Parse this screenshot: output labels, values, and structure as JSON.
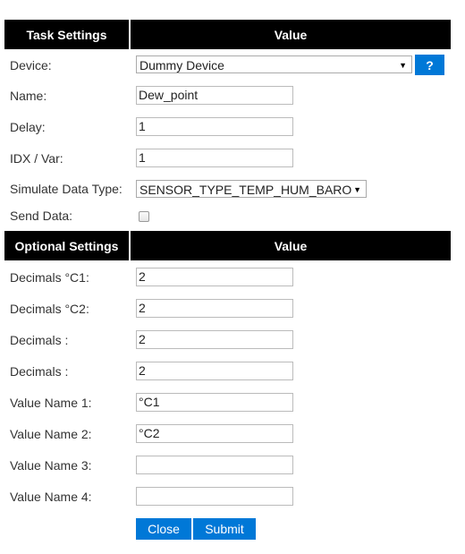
{
  "task_settings": {
    "header_label": "Task Settings",
    "header_value": "Value",
    "device": {
      "label": "Device:",
      "value": "Dummy Device",
      "help_label": "?"
    },
    "name": {
      "label": "Name:",
      "value": "Dew_point"
    },
    "delay": {
      "label": "Delay:",
      "value": "1"
    },
    "idx": {
      "label": "IDX / Var:",
      "value": "1"
    },
    "simulate": {
      "label": "Simulate Data Type:",
      "value": "SENSOR_TYPE_TEMP_HUM_BARO"
    },
    "send_data": {
      "label": "Send Data:",
      "checked": false
    }
  },
  "optional_settings": {
    "header_label": "Optional Settings",
    "header_value": "Value",
    "fields": [
      {
        "label": "Decimals °C1:",
        "value": "2"
      },
      {
        "label": "Decimals °C2:",
        "value": "2"
      },
      {
        "label": "Decimals :",
        "value": "2"
      },
      {
        "label": "Decimals :",
        "value": "2"
      },
      {
        "label": "Value Name 1:",
        "value": "°C1"
      },
      {
        "label": "Value Name 2:",
        "value": "°C2"
      },
      {
        "label": "Value Name 3:",
        "value": ""
      },
      {
        "label": "Value Name 4:",
        "value": ""
      }
    ]
  },
  "actions": {
    "close_label": "Close",
    "submit_label": "Submit"
  },
  "colors": {
    "header_bg": "#000000",
    "accent": "#0078d7"
  }
}
